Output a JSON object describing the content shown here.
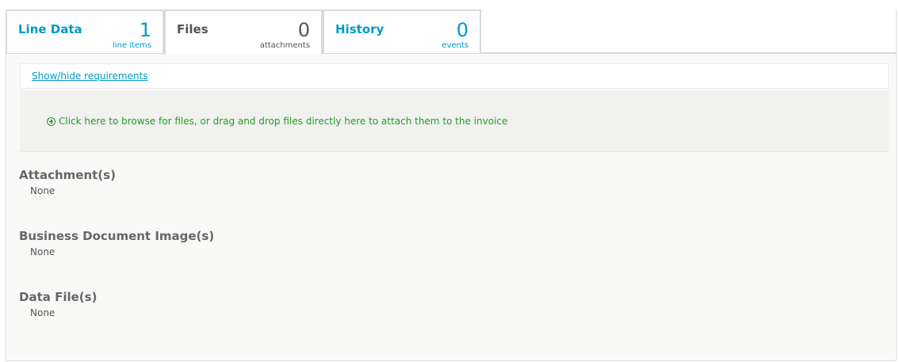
{
  "tabs": [
    {
      "title": "Line Data",
      "count": "1",
      "unit": "line items",
      "active": false
    },
    {
      "title": "Files",
      "count": "0",
      "unit": "attachments",
      "active": true
    },
    {
      "title": "History",
      "count": "0",
      "unit": "events",
      "active": false
    }
  ],
  "requirements": {
    "toggle_label": "Show/hide requirements"
  },
  "dropzone": {
    "text": "Click here to browse for files, or drag and drop files directly here to attach them to the invoice",
    "icon": "plus-circle-icon"
  },
  "sections": [
    {
      "title": "Attachment(s)",
      "value": "None"
    },
    {
      "title": "Business Document Image(s)",
      "value": "None"
    },
    {
      "title": "Data File(s)",
      "value": "None"
    }
  ],
  "colors": {
    "accent": "#0099cc",
    "success": "#22a022",
    "muted_text": "#555555",
    "border": "#d9d9d9"
  }
}
